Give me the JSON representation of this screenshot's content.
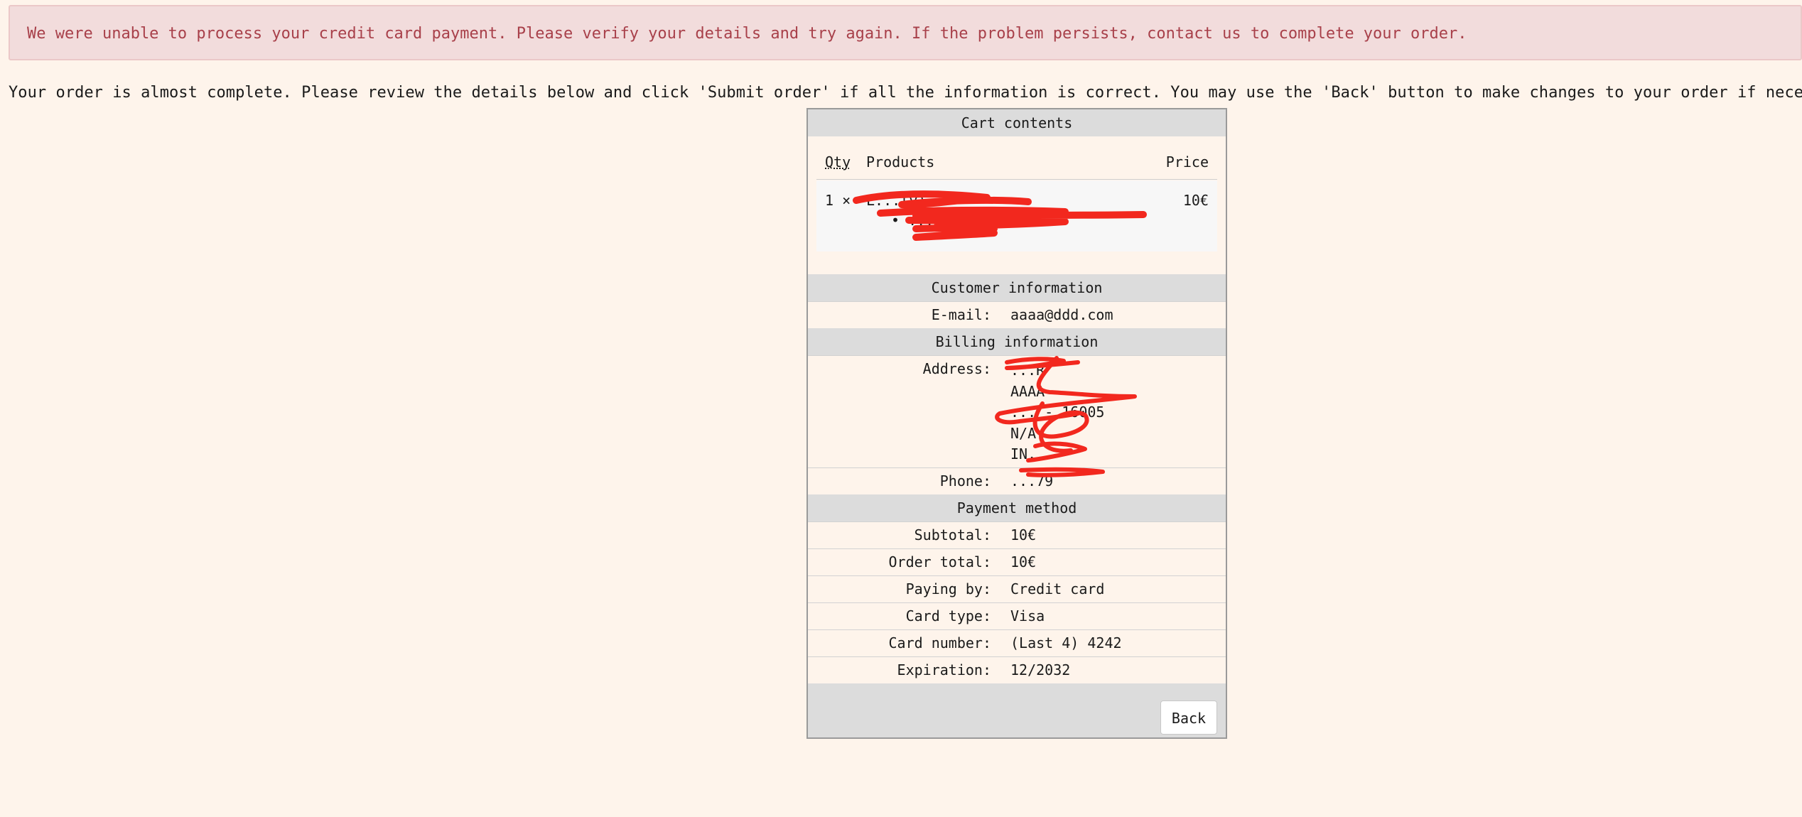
{
  "alert": {
    "message": "We were unable to process your credit card payment. Please verify your details and try again. If the problem persists, contact us to complete your order."
  },
  "intro": "Your order is almost complete. Please review the details below and click 'Submit order' if all the information is correct. You may use the 'Back' button to make changes to your order if necessary.",
  "cart": {
    "header": "Cart contents",
    "columns": {
      "qty": "Qty",
      "products": "Products",
      "price": "Price"
    },
    "item": {
      "qty": "1 ×",
      "name": "L...ly)",
      "attribute": "• ...ct",
      "price": "10€"
    }
  },
  "customer": {
    "header": "Customer information",
    "email_label": "E-mail:",
    "email": "aaaa@ddd.com"
  },
  "billing": {
    "header": "Billing information",
    "address_label": "Address:",
    "address_lines": [
      "...R",
      "AAAA",
      "... - 16005",
      "N/A",
      "IN..."
    ],
    "phone_label": "Phone:",
    "phone": "...79"
  },
  "payment": {
    "header": "Payment method",
    "rows": [
      {
        "label": "Subtotal:",
        "value": "10€"
      },
      {
        "label": "Order total:",
        "value": "10€"
      },
      {
        "label": "Paying by:",
        "value": "Credit card"
      },
      {
        "label": "Card type:",
        "value": "Visa"
      },
      {
        "label": "Card number:",
        "value": "(Last 4) 4242"
      },
      {
        "label": "Expiration:",
        "value": "12/2032"
      }
    ]
  },
  "actions": {
    "back_label": "Back"
  },
  "colors": {
    "background": "#fef4eb",
    "alert_bg": "#f2dcdc",
    "alert_text": "#a8404a",
    "section_header": "#dcdcdc",
    "redaction": "#f2281e"
  }
}
